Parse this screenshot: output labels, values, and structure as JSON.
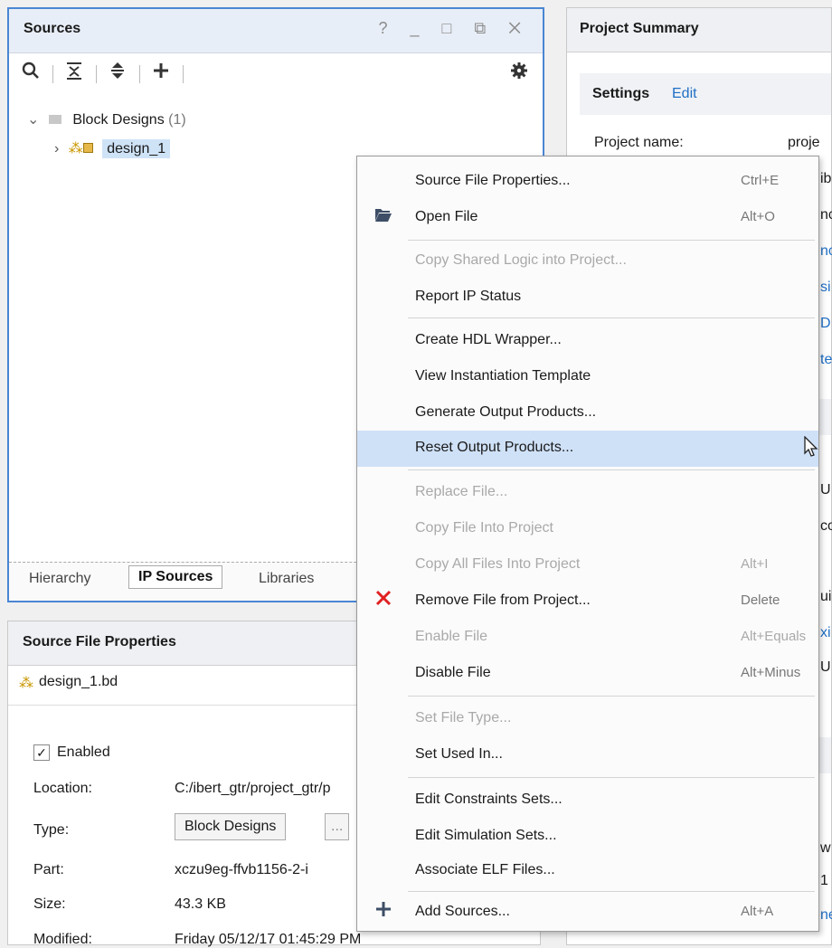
{
  "sources": {
    "title": "Sources",
    "window_buttons": "? _ □ ⧉ ✕",
    "tree": {
      "group_label": "Block Designs",
      "group_count": "(1)",
      "item_label": "design_1"
    },
    "tabs": [
      "Hierarchy",
      "IP Sources",
      "Libraries"
    ]
  },
  "summary": {
    "title": "Project Summary",
    "settings_label": "Settings",
    "edit_label": "Edit",
    "project_name_label": "Project name:",
    "project_name_value": "proje",
    "fragments": [
      "ib",
      "nc",
      "nc",
      "si",
      "D",
      "te",
      "U",
      "co",
      "ui",
      "xi",
      "U",
      "w",
      "1",
      "ne"
    ]
  },
  "props": {
    "title": "Source File Properties",
    "file_name": "design_1.bd",
    "enabled_label": "Enabled",
    "location_label": "Location:",
    "location_value": "C:/ibert_gtr/project_gtr/p",
    "type_label": "Type:",
    "type_value": "Block Designs",
    "type_more": "...",
    "part_label": "Part:",
    "part_value": "xczu9eg-ffvb1156-2-i",
    "size_label": "Size:",
    "size_value": "43.3 KB",
    "modified_label": "Modified:",
    "modified_value": "Friday 05/12/17 01:45:29 PM"
  },
  "menu": {
    "items": [
      {
        "label": "Source File Properties...",
        "shortcut": "Ctrl+E"
      },
      {
        "label": "Open File",
        "shortcut": "Alt+O"
      },
      {
        "label": "Copy Shared Logic into Project...",
        "shortcut": ""
      },
      {
        "label": "Report IP Status",
        "shortcut": ""
      },
      {
        "label": "Create HDL Wrapper...",
        "shortcut": ""
      },
      {
        "label": "View Instantiation Template",
        "shortcut": ""
      },
      {
        "label": "Generate Output Products...",
        "shortcut": ""
      },
      {
        "label": "Reset Output Products...",
        "shortcut": ""
      },
      {
        "label": "Replace File...",
        "shortcut": ""
      },
      {
        "label": "Copy File Into Project",
        "shortcut": ""
      },
      {
        "label": "Copy All Files Into Project",
        "shortcut": "Alt+I"
      },
      {
        "label": "Remove File from Project...",
        "shortcut": "Delete"
      },
      {
        "label": "Enable File",
        "shortcut": "Alt+Equals"
      },
      {
        "label": "Disable File",
        "shortcut": "Alt+Minus"
      },
      {
        "label": "Set File Type...",
        "shortcut": ""
      },
      {
        "label": "Set Used In...",
        "shortcut": ""
      },
      {
        "label": "Edit Constraints Sets...",
        "shortcut": ""
      },
      {
        "label": "Edit Simulation Sets...",
        "shortcut": ""
      },
      {
        "label": "Associate ELF Files...",
        "shortcut": ""
      },
      {
        "label": "Add Sources...",
        "shortcut": "Alt+A"
      }
    ]
  },
  "colors": {
    "accent": "#4a86d4",
    "highlight": "#cfe1f7",
    "remove_icon": "#e02020",
    "link": "#1f6fc5"
  }
}
